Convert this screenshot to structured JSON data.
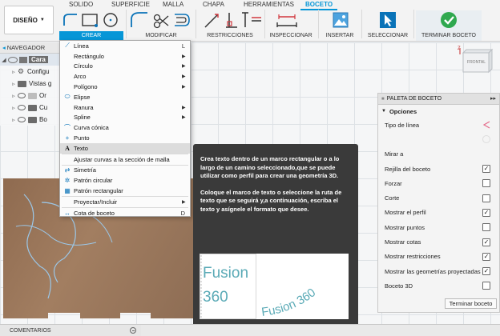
{
  "toolbar": {
    "workspace_label": "DISEÑO",
    "tabs": [
      "SOLIDO",
      "SUPERFICIE",
      "MALLA",
      "CHAPA",
      "HERRAMIENTAS",
      "BOCETO"
    ],
    "groups": [
      "CREAR",
      "MODIFICAR",
      "RESTRICCIONES",
      "INSPECCIONAR",
      "INSERTAR",
      "SELECCIONAR",
      "TERMINAR BOCETO"
    ]
  },
  "browser": {
    "title": "NAVEGADOR",
    "items": [
      "Cara",
      "Configu",
      "Vistas g",
      "Or",
      "Cu",
      "Bo"
    ]
  },
  "viewcube": {
    "face_label": "FRONTAL",
    "axis_label": "Z"
  },
  "create_menu": {
    "items": [
      {
        "label": "Línea",
        "key": "L",
        "icon": "line-icon"
      },
      {
        "label": "Rectángulo",
        "icon": "rectangle-icon"
      },
      {
        "label": "Círculo",
        "icon": "circle-icon"
      },
      {
        "label": "Arco",
        "icon": "arc-icon"
      },
      {
        "label": "Polígono",
        "icon": "polygon-icon"
      },
      {
        "label": "Elipse",
        "icon": "ellipse-icon"
      },
      {
        "label": "Ranura",
        "icon": "slot-icon"
      },
      {
        "label": "Spline",
        "icon": "spline-icon"
      },
      {
        "label": "Curva cónica",
        "icon": "conic-curve-icon"
      },
      {
        "label": "Punto",
        "icon": "point-icon"
      },
      {
        "label": "Texto",
        "icon": "text-icon"
      },
      {
        "label": "Ajustar curvas a la sección de malla",
        "icon": "fit-curves-icon"
      },
      {
        "label": "Simetría",
        "icon": "mirror-icon"
      },
      {
        "label": "Patrón circular",
        "icon": "circular-pattern-icon"
      },
      {
        "label": "Patrón rectangular",
        "icon": "rectangular-pattern-icon"
      },
      {
        "label": "Proyectar/Incluir",
        "icon": "project-icon"
      },
      {
        "label": "Cota de boceto",
        "key": "D",
        "icon": "dimension-icon"
      }
    ]
  },
  "tooltip": {
    "paragraph1": "Crea texto dentro de un marco rectangular o a lo largo de un camino seleccionado,que se puede utilizar como perfil para crear una geometría 3D.",
    "paragraph2": "Coloque el marco de texto o seleccione la ruta de texto que se seguirá y,a continuación, escriba el texto y asígnele el formato que desee.",
    "sample_line1": "Fusion",
    "sample_line2": "360",
    "sample_curved": "Fusion 360"
  },
  "palette": {
    "title": "PALETA DE BOCETO",
    "section": "Opciones",
    "rows": [
      {
        "label": "Tipo de línea",
        "control": "linetype"
      },
      {
        "label": "",
        "control": "disabled-circle"
      },
      {
        "label": "Mirar a",
        "control": "none"
      },
      {
        "label": "Rejilla del boceto",
        "control": "checkbox",
        "checked": true
      },
      {
        "label": "Forzar",
        "control": "checkbox",
        "checked": false
      },
      {
        "label": "Corte",
        "control": "checkbox",
        "checked": false
      },
      {
        "label": "Mostrar el perfil",
        "control": "checkbox",
        "checked": true
      },
      {
        "label": "Mostrar puntos",
        "control": "checkbox",
        "checked": false
      },
      {
        "label": "Mostrar cotas",
        "control": "checkbox",
        "checked": true
      },
      {
        "label": "Mostrar restricciones",
        "control": "checkbox",
        "checked": true
      },
      {
        "label": "Mostrar las geometrías proyectadas",
        "control": "checkbox",
        "checked": true
      },
      {
        "label": "Boceto 3D",
        "control": "checkbox",
        "checked": false
      }
    ],
    "finish_label": "Terminar boceto"
  },
  "comments": {
    "label": "COMENTARIOS"
  },
  "colors": {
    "accent": "#0696d7",
    "finish_green": "#2fa84f",
    "tooltip_bg": "#3a3a3a",
    "wood": "#9e7b5e"
  }
}
